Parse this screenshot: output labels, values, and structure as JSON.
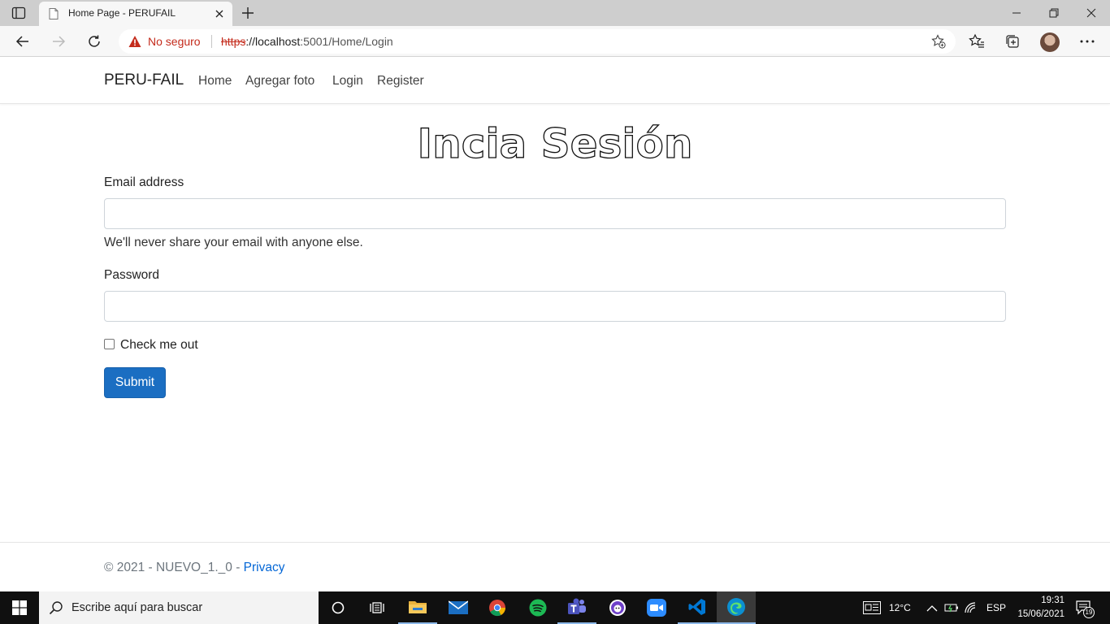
{
  "browser": {
    "tab_title": "Home Page - PERUFAIL",
    "security_label": "No seguro",
    "url_scheme": "https",
    "url_rest_host": "://localhost",
    "url_rest_path": ":5001/Home/Login"
  },
  "site": {
    "brand": "PERU-FAIL",
    "nav": [
      "Home",
      "Agregar foto",
      "Login",
      "Register"
    ]
  },
  "form": {
    "title": "Incia Sesión",
    "email_label": "Email address",
    "email_value": "",
    "email_help": "We'll never share your email with anyone else.",
    "password_label": "Password",
    "password_value": "",
    "checkbox_label": "Check me out",
    "checkbox_checked": false,
    "submit_label": "Submit"
  },
  "footer": {
    "text": "© 2021 - NUEVO_1._0 - ",
    "privacy_label": "Privacy"
  },
  "taskbar": {
    "search_placeholder": "Escribe aquí para buscar",
    "apps": [
      "cortana-icon",
      "task-view-icon",
      "file-explorer-icon",
      "mail-icon",
      "chrome-icon",
      "spotify-icon",
      "teams-icon",
      "github-desktop-icon",
      "zoom-icon",
      "vscode-icon",
      "edge-icon"
    ],
    "temperature": "12°C",
    "language": "ESP",
    "time": "19:31",
    "date": "15/06/2021",
    "notification_count": "19"
  },
  "colors": {
    "primary_button": "#1b6ec2",
    "link": "#0366d6",
    "warning": "#c42b1c"
  }
}
